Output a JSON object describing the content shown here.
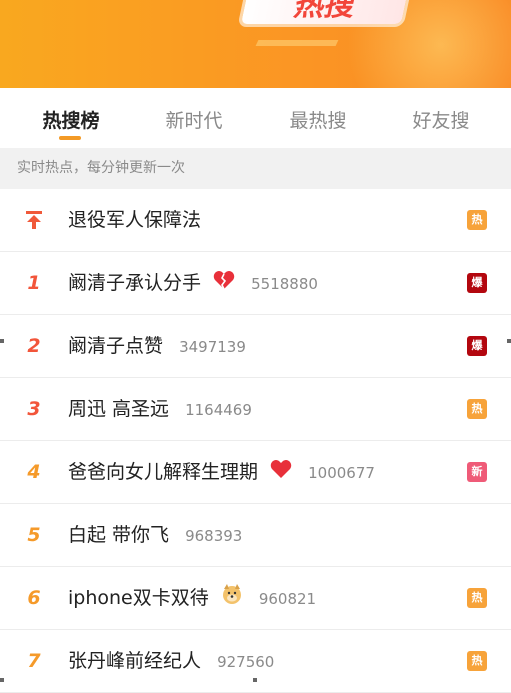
{
  "banner": {
    "logo_text": "热搜"
  },
  "tabs": [
    {
      "label": "热搜榜",
      "active": true
    },
    {
      "label": "新时代",
      "active": false
    },
    {
      "label": "最热搜",
      "active": false
    },
    {
      "label": "好友搜",
      "active": false
    }
  ],
  "subheader": "实时热点，每分钟更新一次",
  "rows": [
    {
      "rank": "",
      "title": "退役军人保障法",
      "count": "",
      "badge": "热",
      "badge_type": "hot",
      "emoji": ""
    },
    {
      "rank": "1",
      "title": "阚清子承认分手",
      "count": "5518880",
      "badge": "爆",
      "badge_type": "boom",
      "emoji": "broken-heart"
    },
    {
      "rank": "2",
      "title": "阚清子点赞",
      "count": "3497139",
      "badge": "爆",
      "badge_type": "boom",
      "emoji": ""
    },
    {
      "rank": "3",
      "title": "周迅 高圣远",
      "count": "1164469",
      "badge": "热",
      "badge_type": "hot",
      "emoji": ""
    },
    {
      "rank": "4",
      "title": "爸爸向女儿解释生理期",
      "count": "1000677",
      "badge": "新",
      "badge_type": "new",
      "emoji": "heart"
    },
    {
      "rank": "5",
      "title": "白起 带你飞",
      "count": "968393",
      "badge": "",
      "badge_type": "",
      "emoji": ""
    },
    {
      "rank": "6",
      "title": "iphone双卡双待",
      "count": "960821",
      "badge": "热",
      "badge_type": "hot",
      "emoji": "doge"
    },
    {
      "rank": "7",
      "title": "张丹峰前经纪人",
      "count": "927560",
      "badge": "热",
      "badge_type": "hot",
      "emoji": ""
    }
  ],
  "colors": {
    "accent": "#f39a26",
    "rank_top": "#f2553a",
    "rank_rest": "#f59a2a",
    "badge_hot": "#f7a33a",
    "badge_boom": "#b3070f",
    "badge_new": "#ef5b78"
  }
}
